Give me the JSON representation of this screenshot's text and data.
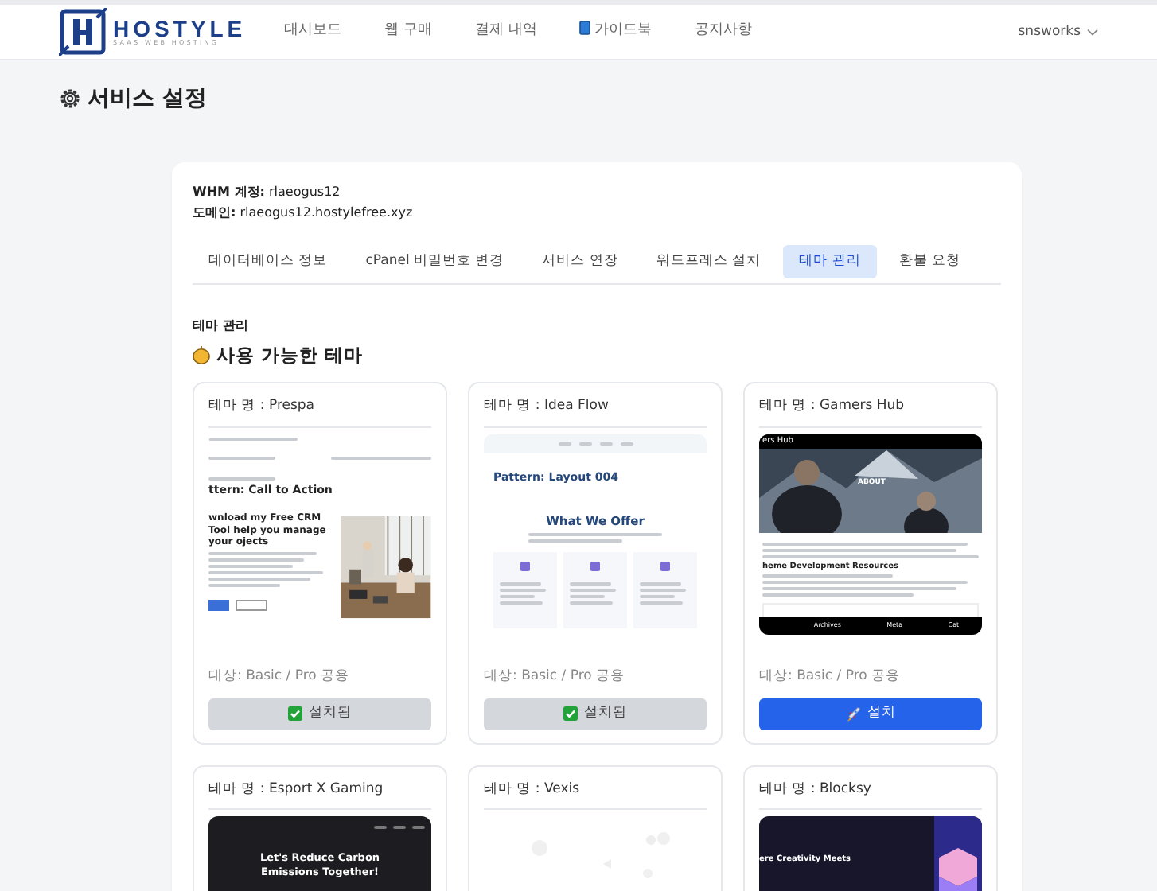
{
  "nav": {
    "logo": {
      "name": "HOSTYLE",
      "tagline": "SAAS WEB HOSTING"
    },
    "menu": [
      {
        "label": "대시보드",
        "kind": "text",
        "selected": false
      },
      {
        "label": "웹 구매",
        "kind": "text",
        "selected": false
      },
      {
        "label": "결제 내역",
        "kind": "text",
        "selected": false
      },
      {
        "label": "가이드북",
        "kind": "book",
        "selected": false
      },
      {
        "label": "공지사항",
        "kind": "text",
        "selected": false
      }
    ],
    "user": "snsworks"
  },
  "page_title": "서비스 설정",
  "account": [
    {
      "label": "WHM 계정:",
      "value": "rlaeogus12"
    },
    {
      "label": "도메인:",
      "value": "rlaeogus12.hostylefree.xyz"
    }
  ],
  "tabs": [
    {
      "label": "데이터베이스 정보",
      "selected": false
    },
    {
      "label": "cPanel 비밀번호 변경",
      "selected": false
    },
    {
      "label": "서비스 연장",
      "selected": false
    },
    {
      "label": "워드프레스 설치",
      "selected": false
    },
    {
      "label": "테마 관리",
      "selected": true
    },
    {
      "label": "환불 요청",
      "selected": false
    }
  ],
  "section_label": "테마 관리",
  "section_heading": "사용 가능한 테마",
  "themes": [
    {
      "name": "테마 명 : Prespa",
      "preview": {
        "kind": "cta",
        "title": "ttern: Call to Action",
        "lead": "wnload my Free CRM Tool help you manage your ojects"
      },
      "target": "대상: Basic / Pro 공용",
      "installed": true,
      "button": "설치됨"
    },
    {
      "name": "테마 명 : Idea Flow",
      "preview": {
        "kind": "services",
        "title": "Pattern: Layout 004",
        "heading": "What We Offer"
      },
      "target": "대상: Basic / Pro 공용",
      "installed": true,
      "button": "설치됨"
    },
    {
      "name": "테마 명 : Gamers Hub",
      "preview": {
        "kind": "blog",
        "site": "ers Hub",
        "hero_label": "ABOUT",
        "heading": "heme Development Resources",
        "footer_links": [
          "Archives",
          "Meta",
          "Cat"
        ]
      },
      "target": "대상: Basic / Pro 공용",
      "installed": false,
      "button": "설치"
    },
    {
      "name": "테마 명 : Esport X Gaming",
      "preview": {
        "kind": "dark-hero",
        "heading": "Let's Reduce Carbon Emissions Together!"
      }
    },
    {
      "name": "테마 명 : Vexis",
      "preview": {
        "kind": "blank"
      }
    },
    {
      "name": "테마 명 : Blocksy",
      "preview": {
        "kind": "split",
        "heading": "ere Creativity Meets"
      }
    }
  ]
}
